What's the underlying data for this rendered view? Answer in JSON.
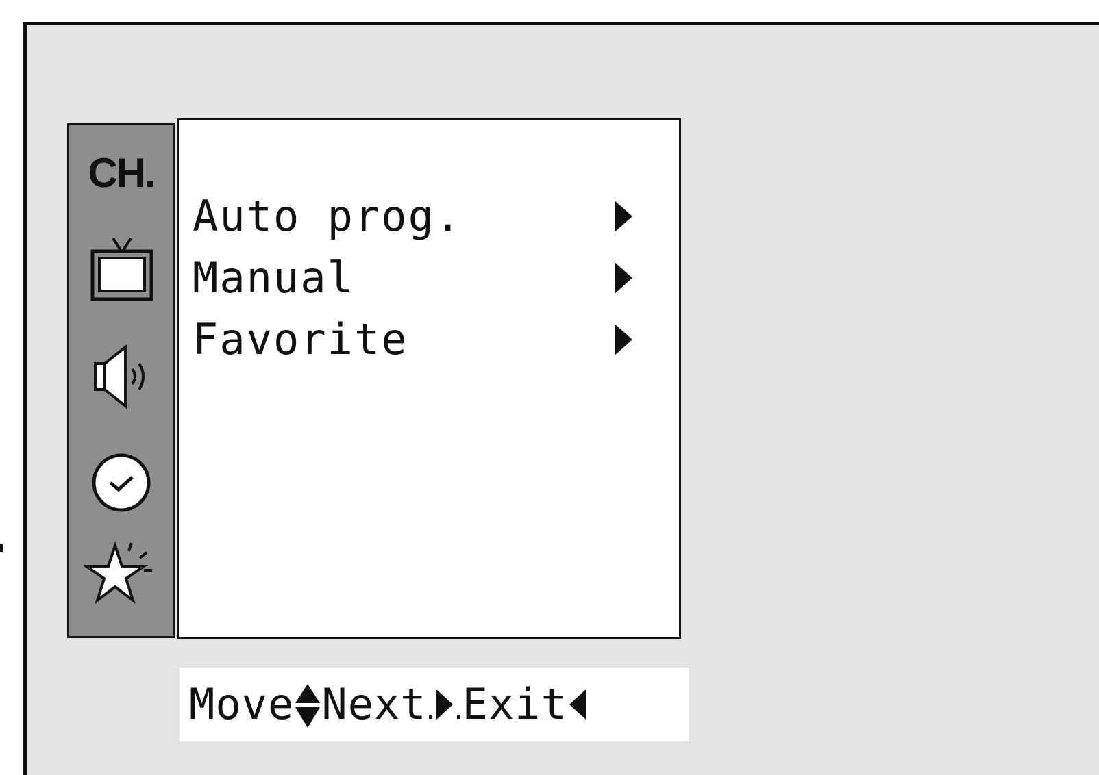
{
  "menu": {
    "category_label": "CH.",
    "sidebar_icons": [
      "tv-icon",
      "speaker-icon",
      "clock-icon",
      "star-icon"
    ],
    "items": [
      {
        "label": "Auto prog.",
        "arrow": "arrow-right-icon"
      },
      {
        "label": "Manual",
        "arrow": "arrow-right-icon"
      },
      {
        "label": "Favorite",
        "arrow": "arrow-right-icon"
      }
    ]
  },
  "footer": {
    "move_label": "Move",
    "next_label": "Next",
    "exit_label": "Exit"
  },
  "colors": {
    "screen_background": "#e3e3e3",
    "sidebar": "#8f8f8f",
    "panel": "#ffffff",
    "ink": "#111111"
  }
}
